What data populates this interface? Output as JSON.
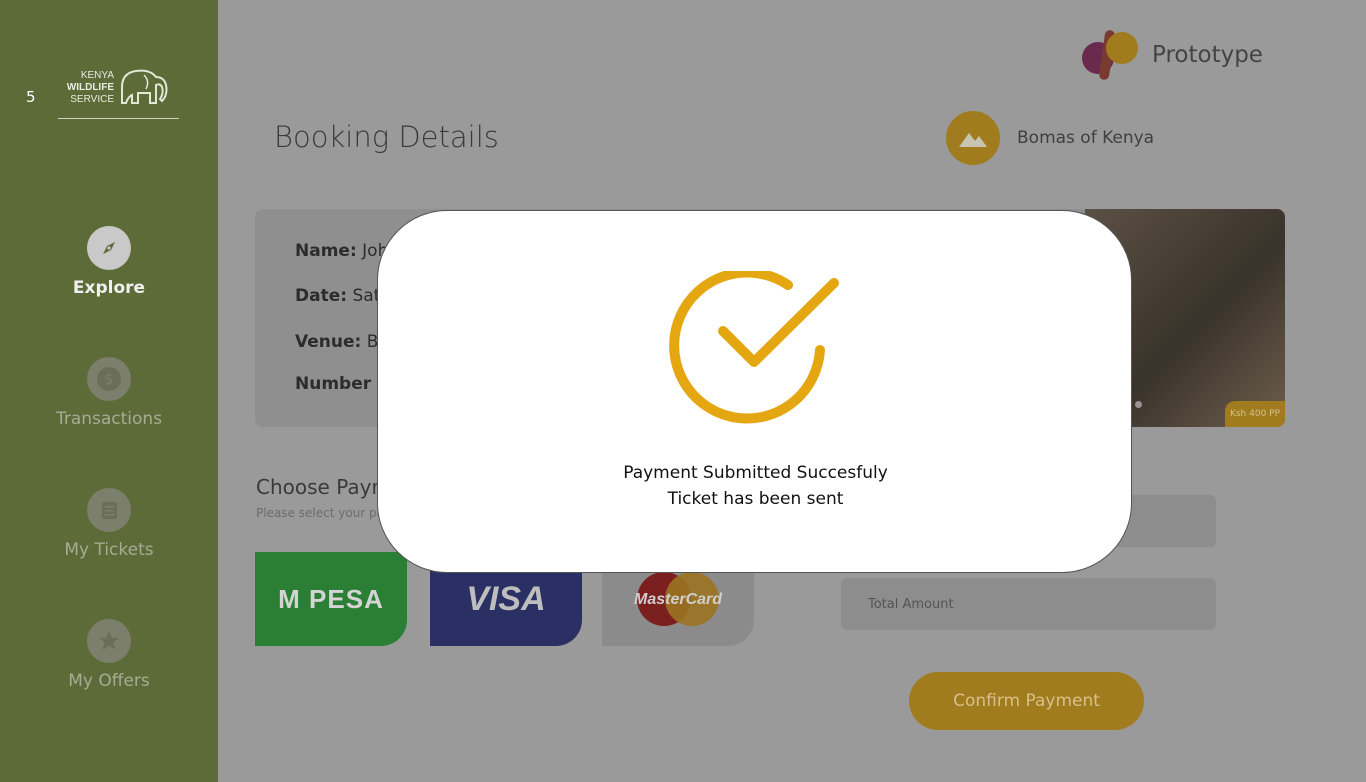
{
  "sidebar": {
    "page_number": "5",
    "logo": {
      "line1": "KENYA",
      "line2": "WILDLIFE",
      "line3": "SERVICE"
    },
    "items": [
      {
        "label": "Explore",
        "icon": "compass-icon",
        "active": true
      },
      {
        "label": "Transactions",
        "icon": "dollar-icon",
        "active": false
      },
      {
        "label": "My Tickets",
        "icon": "ticket-icon",
        "active": false
      },
      {
        "label": "My Offers",
        "icon": "star-icon",
        "active": false
      }
    ]
  },
  "header": {
    "brand_name": "Prototype",
    "page_title": "Booking Details",
    "venue": "Bomas of Kenya"
  },
  "booking": {
    "name_label": "Name:",
    "name_value": "Joh",
    "date_label": "Date:",
    "date_value": "Satu",
    "venue_label": "Venue:",
    "venue_value": "Bo",
    "number_label": "Number o",
    "price_tag": "Ksh 400 PP"
  },
  "payment": {
    "heading": "Choose Paym",
    "subheading": "Please select your pa",
    "methods": [
      "M-PESA",
      "VISA",
      "MasterCard"
    ],
    "mpesa_label": "M PESA",
    "visa_label": "VISA",
    "mastercard_label": "MasterCard",
    "total_placeholder": "Total Amount",
    "confirm_label": "Confirm Payment"
  },
  "modal": {
    "line1": "Payment Submitted Succesfuly",
    "line2": "Ticket has been sent",
    "icon": "checkmark-circle-icon",
    "accent_color": "#E5A711"
  },
  "colors": {
    "sidebar": "#5D6B38",
    "overlay": "#9A9A9A",
    "accent": "#E5A711"
  }
}
